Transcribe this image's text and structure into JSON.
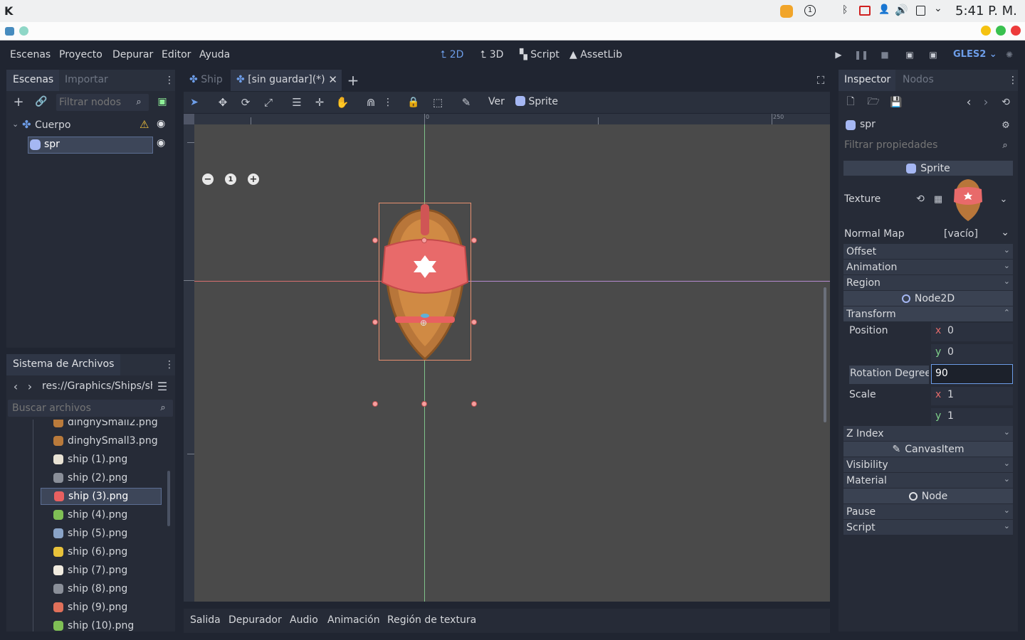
{
  "taskbar": {
    "clock": "5:41 P. M."
  },
  "menu": {
    "items": [
      "Escenas",
      "Proyecto",
      "Depurar",
      "Editor",
      "Ayuda"
    ]
  },
  "workspace": {
    "two_d": "2D",
    "three_d": "3D",
    "script": "Script",
    "assetlib": "AssetLib"
  },
  "renderer": "GLES2",
  "scene_dock": {
    "tab_active": "Escenas",
    "tab_inactive": "Importar",
    "filter_placeholder": "Filtrar nodos",
    "tree": [
      {
        "label": "Cuerpo"
      },
      {
        "label": "spr"
      }
    ]
  },
  "filesystem": {
    "title": "Sistema de Archivos",
    "path": "res://Graphics/Ships/sh",
    "search_placeholder": "Buscar archivos",
    "files": [
      "dinghySmall2.png",
      "dinghySmall3.png",
      "ship (1).png",
      "ship (2).png",
      "ship (3).png",
      "ship (4).png",
      "ship (5).png",
      "ship (6).png",
      "ship (7).png",
      "ship (8).png",
      "ship (9).png",
      "ship (10).png"
    ],
    "selected": "ship (3).png"
  },
  "editor_tabs": {
    "tab1": "Ship",
    "tab2": "[sin guardar](*)"
  },
  "toolbar": {
    "view": "Ver",
    "sprite": "Sprite"
  },
  "ruler": {
    "zero": "0",
    "mark": "250"
  },
  "bottom_tabs": [
    "Salida",
    "Depurador",
    "Audio",
    "Animación",
    "Región de textura"
  ],
  "inspector": {
    "tab_active": "Inspector",
    "tab_inactive": "Nodos",
    "node_name": "spr",
    "filter_placeholder": "Filtrar propiedades",
    "class_sprite": "Sprite",
    "texture_label": "Texture",
    "normal_map_label": "Normal Map",
    "normal_map_value": "[vacío]",
    "sprite_sections": [
      "Offset",
      "Animation",
      "Region"
    ],
    "class_node2d": "Node2D",
    "transform": "Transform",
    "position_label": "Position",
    "position_x": "0",
    "position_y": "0",
    "rotation_label": "Rotation Degree",
    "rotation_value": "90",
    "scale_label": "Scale",
    "scale_x": "1",
    "scale_y": "1",
    "axis_x": "x",
    "axis_y": "y",
    "z_index": "Z Index",
    "class_canvasitem": "CanvasItem",
    "canvasitem_sections": [
      "Visibility",
      "Material"
    ],
    "class_node": "Node",
    "node_sections": [
      "Pause",
      "Script"
    ]
  },
  "colors": {
    "accent": "#6d9de8",
    "selection": "#e89070",
    "ship_red": "#e86060",
    "ship_brown": "#c07b3a"
  }
}
